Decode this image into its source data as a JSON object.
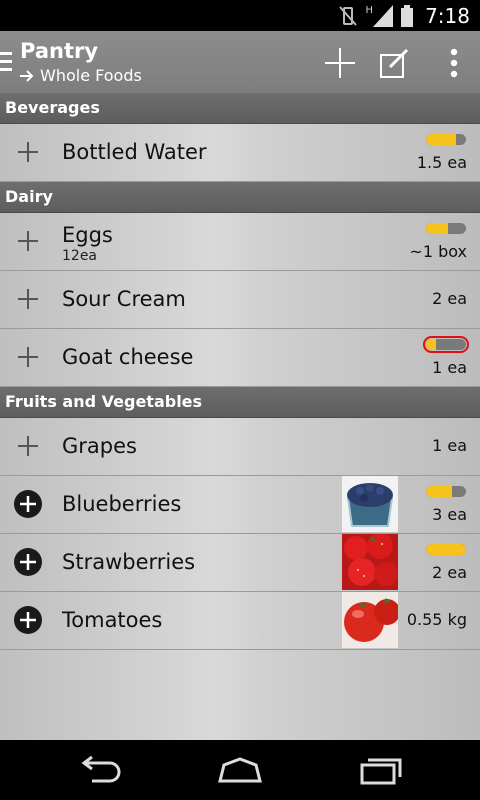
{
  "status_bar": {
    "time": "7:18",
    "network": "H"
  },
  "action_bar": {
    "title": "Pantry",
    "subtitle": "Whole Foods",
    "actions": [
      {
        "name": "add-button",
        "icon": "plus-icon"
      },
      {
        "name": "edit-button",
        "icon": "edit-icon"
      },
      {
        "name": "overflow-menu-button",
        "icon": "more-vert-icon"
      }
    ]
  },
  "sections": [
    {
      "title": "Beverages",
      "items": [
        {
          "name": "Bottled Water",
          "qty": "1.5 ea",
          "level": 0.75
        }
      ]
    },
    {
      "title": "Dairy",
      "items": [
        {
          "name": "Eggs",
          "sub": "12ea",
          "qty": "~1 box",
          "level": 0.55
        },
        {
          "name": "Sour Cream",
          "qty": "2 ea"
        },
        {
          "name": "Goat cheese",
          "qty": "1 ea",
          "level": 0.25,
          "alert": true
        }
      ]
    },
    {
      "title": "Fruits and Vegetables",
      "items": [
        {
          "name": "Grapes",
          "qty": "1 ea"
        },
        {
          "name": "Blueberries",
          "qty": "3 ea",
          "level": 0.65,
          "image": "blueberries-photo",
          "circle_plus": true
        },
        {
          "name": "Strawberries",
          "qty": "2 ea",
          "level": 1.0,
          "image": "strawberries-photo",
          "circle_plus": true
        },
        {
          "name": "Tomatoes",
          "qty": "0.55 kg",
          "image": "tomatoes-photo",
          "circle_plus": true
        }
      ]
    }
  ],
  "colors": {
    "accent": "#f6c21b",
    "alert": "#e01010",
    "header": "#636363"
  }
}
